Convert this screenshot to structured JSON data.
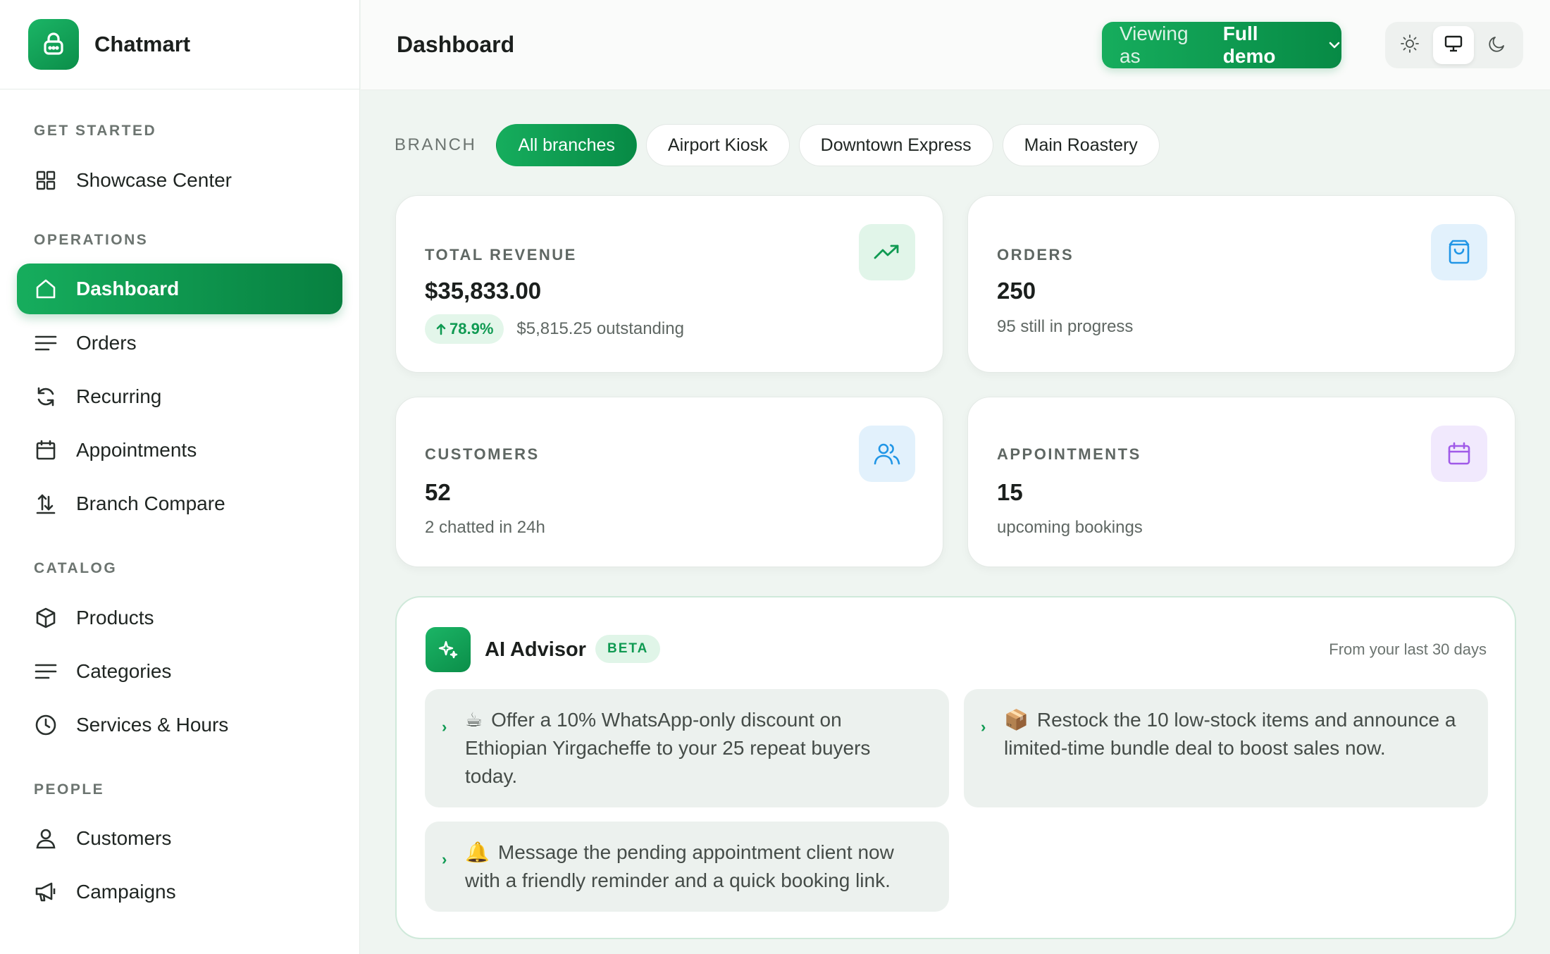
{
  "app": {
    "name": "Chatmart"
  },
  "sidebar": {
    "sections": [
      {
        "title": "GET STARTED",
        "items": [
          {
            "label": "Showcase Center",
            "icon": "grid-icon"
          }
        ]
      },
      {
        "title": "OPERATIONS",
        "items": [
          {
            "label": "Dashboard",
            "icon": "home-icon",
            "active": true
          },
          {
            "label": "Orders",
            "icon": "list-icon"
          },
          {
            "label": "Recurring",
            "icon": "refresh-icon"
          },
          {
            "label": "Appointments",
            "icon": "calendar-icon"
          },
          {
            "label": "Branch Compare",
            "icon": "compare-icon"
          }
        ]
      },
      {
        "title": "CATALOG",
        "items": [
          {
            "label": "Products",
            "icon": "box-icon"
          },
          {
            "label": "Categories",
            "icon": "list-icon"
          },
          {
            "label": "Services & Hours",
            "icon": "clock-icon"
          }
        ]
      },
      {
        "title": "PEOPLE",
        "items": [
          {
            "label": "Customers",
            "icon": "user-icon"
          },
          {
            "label": "Campaigns",
            "icon": "megaphone-icon"
          }
        ]
      }
    ]
  },
  "header": {
    "title": "Dashboard",
    "viewing_prefix": "Viewing as",
    "viewing_value": "Full demo",
    "theme_options": [
      "light",
      "system",
      "dark"
    ],
    "theme_selected": "system"
  },
  "branch": {
    "label": "BRANCH",
    "options": [
      "All branches",
      "Airport Kiosk",
      "Downtown Express",
      "Main Roastery"
    ],
    "selected": "All branches"
  },
  "stats": {
    "revenue": {
      "label": "TOTAL REVENUE",
      "value": "$35,833.00",
      "change": "78.9%",
      "note": "$5,815.25 outstanding"
    },
    "orders": {
      "label": "ORDERS",
      "value": "250",
      "note": "95 still in progress"
    },
    "customers": {
      "label": "CUSTOMERS",
      "value": "52",
      "note": "2 chatted in 24h"
    },
    "appointments": {
      "label": "APPOINTMENTS",
      "value": "15",
      "note": "upcoming bookings"
    }
  },
  "advisor": {
    "title": "AI Advisor",
    "badge": "BETA",
    "note": "From your last 30 days",
    "tips": [
      {
        "emoji": "☕",
        "text": "Offer a 10% WhatsApp-only discount on Ethiopian Yirgacheffe to your 25 repeat buyers today."
      },
      {
        "emoji": "📦",
        "text": "Restock the 10 low-stock items and announce a limited-time bundle deal to boost sales now."
      },
      {
        "emoji": "🔔",
        "text": "Message the pending appointment client now with a friendly reminder and a quick booking link."
      }
    ]
  },
  "colors": {
    "accent": "#0f9a52",
    "accent_dark": "#078040",
    "background": "#eff5f1"
  }
}
